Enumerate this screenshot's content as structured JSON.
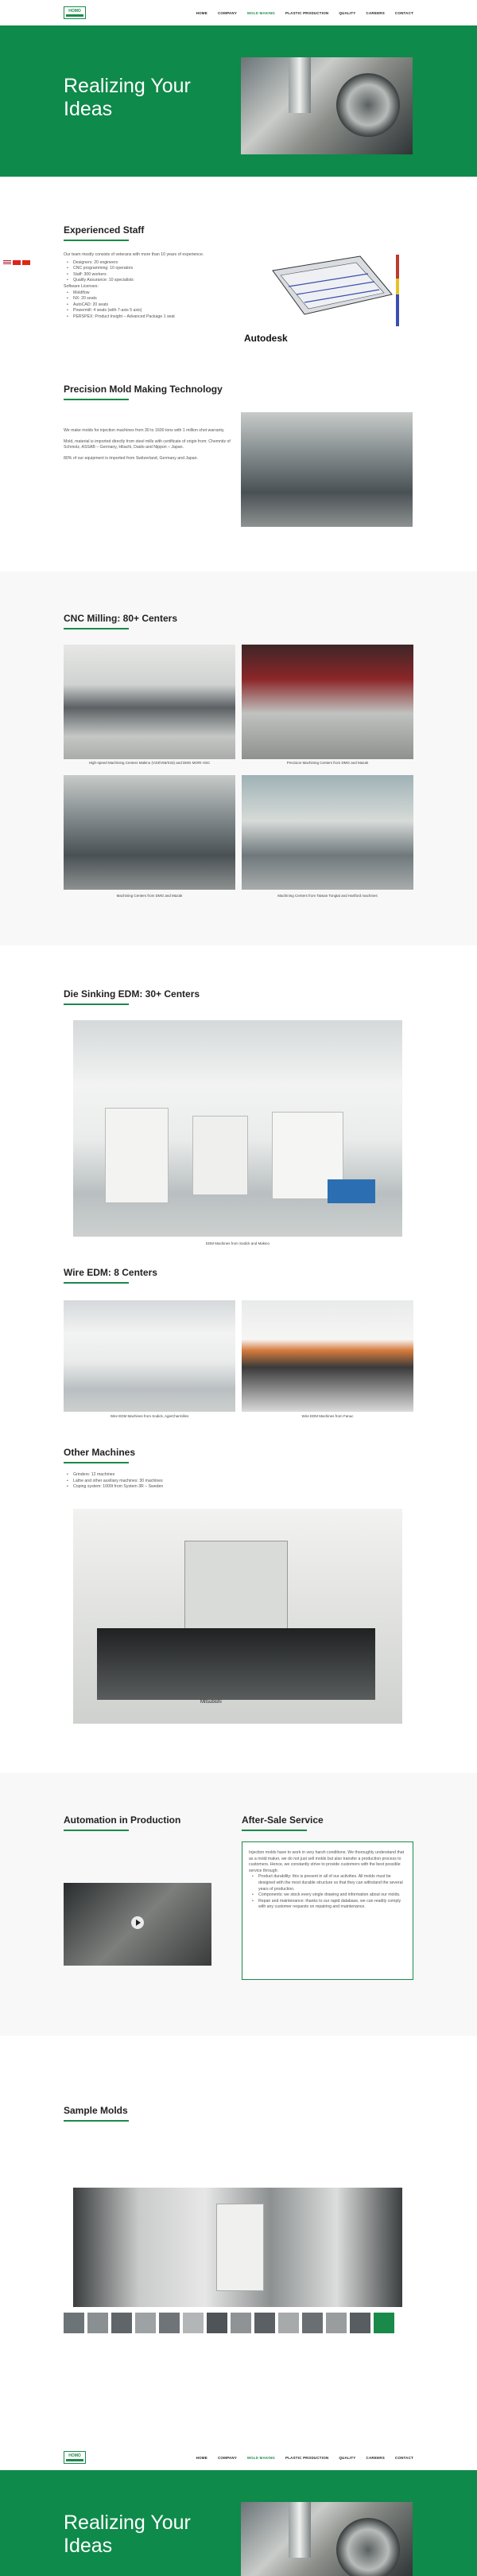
{
  "nav": {
    "logo_text": "HOMO",
    "items": [
      {
        "label": "HOME"
      },
      {
        "label": "COMPANY"
      },
      {
        "label": "MOLD MAKING"
      },
      {
        "label": "PLASTIC PRODUCTION"
      },
      {
        "label": "QUALITY"
      },
      {
        "label": "CAREERS"
      },
      {
        "label": "CONTACT"
      }
    ],
    "active_index": 2
  },
  "hero": {
    "title": "Realizing Your Ideas"
  },
  "staff": {
    "title": "Experienced Staff",
    "intro": "Our team mostly consists of veterans with more than 10 years of experience.",
    "bullets": [
      "Designers: 20 engineers",
      "CNC programming: 10 operators",
      "Staff: 300 workers",
      "Quality Assurance: 10 specialists"
    ],
    "software_label": "Software Licenses:",
    "software": [
      "Moldflow",
      "NX: 20 seats",
      "AutoCAD: 20 seats",
      "Powermill: 4 seats (with 7-axis 5 axis)",
      "PERSPEX: Product Insight – Advanced Package 1 seat"
    ],
    "image_brand": "Autodesk"
  },
  "precision": {
    "title": "Precision Mold Making Technology",
    "paragraphs": [
      "We make molds for injection machines from 30 to 1600 tons with 1 million shot warranty.",
      "Mold, material is imported directly from steel mills with certificate of origin from: Chemnitz of Schmolz, ASSAB – Germany, Hitachi, Daido and Nippon – Japan.",
      "80% of our equipment is imported from Switzerland, Germany and Japan."
    ]
  },
  "cnc": {
    "title": "CNC Milling: 80+ Centers",
    "captions": [
      "High-speed Machining Centers Makino (V33/V56/S33) and DMG MORI HSC",
      "Precision Machining Centers from DMG and Mazak",
      "Machining Centers from DMG and Mazak",
      "Machining Centers from Taiwan Tongtai and Hartford machines"
    ]
  },
  "edm": {
    "title": "Die Sinking EDM: 30+ Centers",
    "caption": "EDM Machines from Sodick and Makino"
  },
  "wire": {
    "title": "Wire EDM: 8 Centers",
    "captions": [
      "Wire EDM Machines from Sodick, AgieCharmilles",
      "Wire EDM Machines from Fanuc"
    ]
  },
  "other": {
    "title": "Other Machines",
    "bullets": [
      "Grinders: 12 machines",
      "Lathe and other auxiliary machines: 30 machines",
      "Coping system: 1000t from System 3R – Sweden"
    ],
    "machine_brand": "Mitsubishi"
  },
  "automation": {
    "title": "Automation in Production"
  },
  "aftersale": {
    "title": "After-Sale Service",
    "intro": "Injection molds have to work in very harsh conditions. We thoroughly understand that as a mold maker, we do not just sell molds but also transfer a production process to customers. Hence, we constantly strive to provide customers with the best possible service through:",
    "bullets": [
      "Product durability: this is present in all of our activities. All molds must be designed with the most durable structure so that they can withstand the several years of production.",
      "Components: we stock every single drawing and information about our molds.",
      "Repair and maintenance: thanks to our rapid database, we can readily comply with any customer requests on repairing and maintenance."
    ]
  },
  "samples": {
    "title": "Sample Molds"
  },
  "footer_hero": {
    "title": "Realizing Your Ideas"
  },
  "colors": {
    "brand": "#0e8a4a",
    "accent_line": "#1a8a4a"
  },
  "icons": [
    "flag-us-icon",
    "flag-vn-icon",
    "flag-cn-icon",
    "play-icon"
  ]
}
